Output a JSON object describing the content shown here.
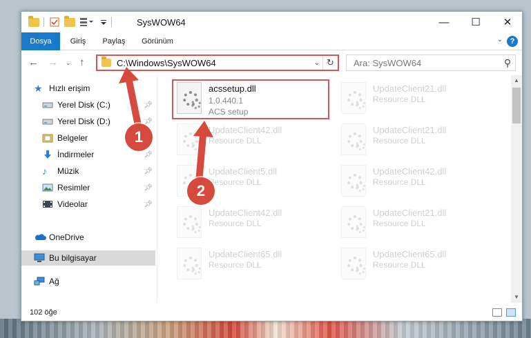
{
  "window": {
    "title": "SysWOW64",
    "minimize_label": "—",
    "maximize_label": "☐",
    "close_label": "✕"
  },
  "ribbon": {
    "tabs": [
      "Dosya",
      "Giriş",
      "Paylaş",
      "Görünüm"
    ],
    "active_tab": "Dosya"
  },
  "nav": {
    "address": "C:\\Windows\\SysWOW64",
    "search_placeholder": "Ara: SysWOW64"
  },
  "sidebar": {
    "items": [
      {
        "label": "Hızlı erişim",
        "icon": "star-icon"
      },
      {
        "label": "Yerel Disk (C:)",
        "icon": "drive-icon"
      },
      {
        "label": "Yerel Disk (D:)",
        "icon": "drive-icon"
      },
      {
        "label": "Belgeler",
        "icon": "documents-icon"
      },
      {
        "label": "İndirmeler",
        "icon": "download-icon"
      },
      {
        "label": "Müzik",
        "icon": "music-icon"
      },
      {
        "label": "Resimler",
        "icon": "pictures-icon"
      },
      {
        "label": "Videolar",
        "icon": "video-icon"
      },
      {
        "label": "OneDrive",
        "icon": "cloud-icon"
      },
      {
        "label": "Bu bilgisayar",
        "icon": "computer-icon"
      },
      {
        "label": "Ağ",
        "icon": "network-icon"
      }
    ],
    "selected": "Bu bilgisayar"
  },
  "files": [
    {
      "name": "acssetup.dll",
      "version": "1.0.440.1",
      "description": "ACS setup",
      "highlighted": true
    },
    {
      "name": "UpdateClient21.dll",
      "description": "Resource DLL"
    },
    {
      "name": "UpdateClient42.dll",
      "description": "Resource DLL"
    },
    {
      "name": "UpdateClient21.dll",
      "description": "Resource DLL"
    },
    {
      "name": "UpdateClient5.dll",
      "description": "Resource DLL"
    },
    {
      "name": "UpdateClient42.dll",
      "description": "Resource DLL"
    },
    {
      "name": "UpdateClient42.dll",
      "description": "Resource DLL"
    },
    {
      "name": "UpdateClient21.dll",
      "description": "Resource DLL"
    },
    {
      "name": "UpdateClient65.dll",
      "description": "Resource DLL"
    },
    {
      "name": "UpdateClient65.dll",
      "description": "Resource DLL"
    }
  ],
  "status": {
    "item_count": "102 öğe"
  },
  "annotations": {
    "step1": "1",
    "step2": "2",
    "color": "#d64a3e"
  },
  "colors": {
    "accent": "#1979ca",
    "highlight_border": "#d9534f"
  }
}
